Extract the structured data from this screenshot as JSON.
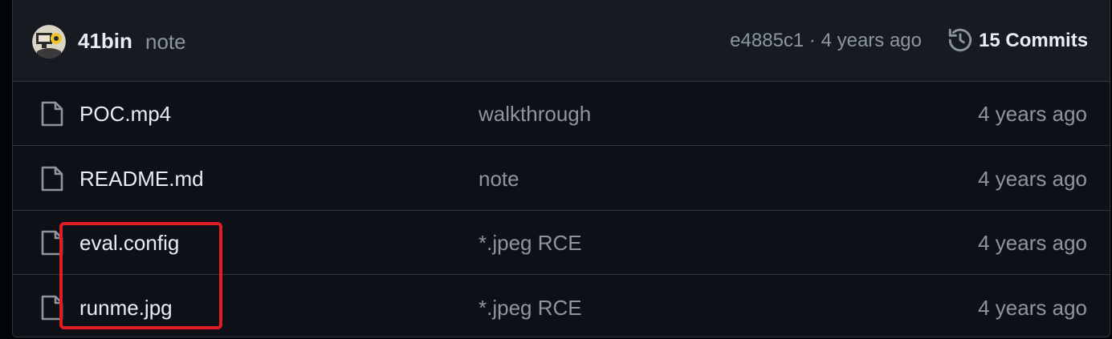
{
  "latest_commit": {
    "author": "41bin",
    "message": "note",
    "hash_time": "e4885c1 · 4 years ago",
    "commits_label": "15 Commits"
  },
  "files": [
    {
      "name": "POC.mp4",
      "commit": "walkthrough",
      "time": "4 years ago"
    },
    {
      "name": "README.md",
      "commit": "note",
      "time": "4 years ago"
    },
    {
      "name": "eval.config",
      "commit": "*.jpeg RCE",
      "time": "4 years ago"
    },
    {
      "name": "runme.jpg",
      "commit": "*.jpeg RCE",
      "time": "4 years ago"
    }
  ],
  "colors": {
    "highlight": "#e11d24",
    "background": "#0d1117",
    "header": "#161b22",
    "border": "#30363d"
  },
  "icons": {
    "avatar": "avatar-image",
    "history": "history-icon",
    "file": "file-icon"
  }
}
